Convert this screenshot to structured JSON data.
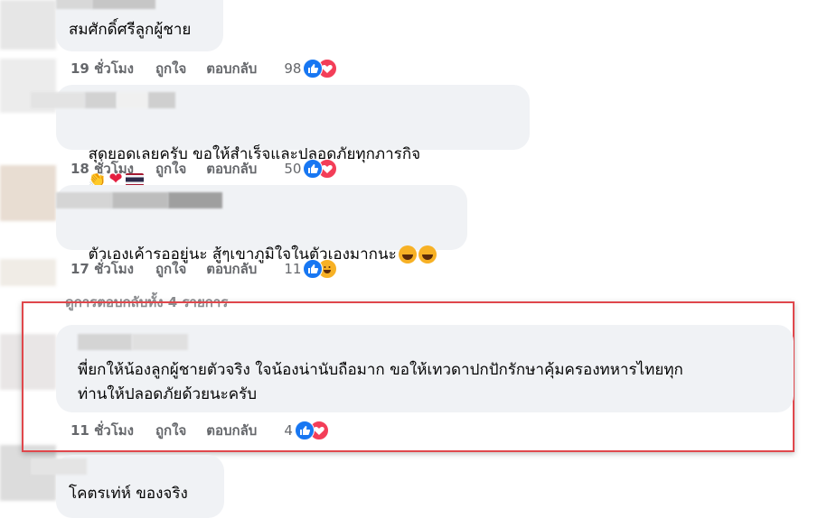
{
  "comments": [
    {
      "text": "สมศักดิ์ศรีลูกผู้ชาย",
      "time": "19 ชั่วโมง",
      "like": "ถูกใจ",
      "reply": "ตอบกลับ",
      "count": "98",
      "reactions": [
        "like-icon",
        "love-icon"
      ]
    },
    {
      "text": "สุดยอดเลยครับ ขอให้สำเร็จและปลอดภัยทุกภารกิจ",
      "time": "18 ชั่วโมง",
      "like": "ถูกใจ",
      "reply": "ตอบกลับ",
      "count": "50",
      "reactions": [
        "like-icon",
        "love-icon"
      ],
      "trailing_emoji": [
        "clap-emoji",
        "red-heart-emoji",
        "thai-flag-emoji"
      ]
    },
    {
      "text": "ตัวเองเค้ารออยู่นะ สู้ๆเขาภูมิใจในตัวเองมากนะ",
      "time": "17 ชั่วโมง",
      "like": "ถูกใจ",
      "reply": "ตอบกลับ",
      "count": "11",
      "reactions": [
        "like-icon",
        "haha-icon"
      ],
      "trailing_emoji": [
        "laughing-tears-emoji",
        "laughing-tears-emoji"
      ]
    },
    {
      "text_line1": "พี่ยกให้น้องลูกผู้ชายตัวจริง ใจน้องน่านับถือมาก ขอให้เทวดาปกปักรักษาคุ้มครองทหารไทยทุก",
      "text_line2": "ท่านให้ปลอดภัยด้วยนะครับ",
      "time": "11 ชั่วโมง",
      "like": "ถูกใจ",
      "reply": "ตอบกลับ",
      "count": "4",
      "reactions": [
        "like-icon",
        "love-icon"
      ],
      "highlighted": true
    },
    {
      "text": "โคตรเท่ห์ ของจริง"
    }
  ],
  "view_replies": "ดูการตอบกลับทั้ง 4 รายการ",
  "colors": {
    "bubble": "#f0f2f5",
    "meta_text": "#65676b",
    "like_blue": "#1877f2",
    "love_red": "#f33e58",
    "highlight_border": "#e0474c"
  }
}
